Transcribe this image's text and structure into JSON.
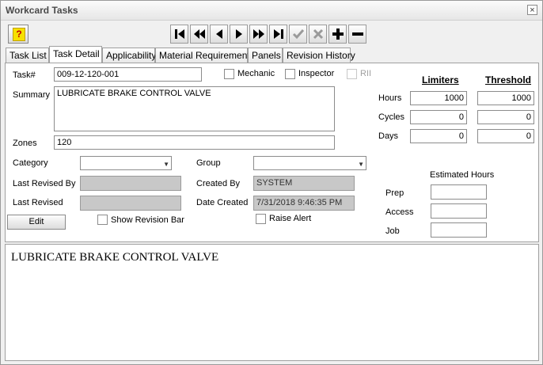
{
  "window": {
    "title": "Workcard Tasks",
    "close_glyph": "×"
  },
  "toolbar": {
    "help_glyph": "?",
    "buttons": [
      "first-icon",
      "prev-page-icon",
      "prev-icon",
      "next-icon",
      "next-page-icon",
      "last-icon",
      "check-icon",
      "cancel-icon",
      "add-icon",
      "remove-icon"
    ]
  },
  "tabs": [
    "Task List",
    "Task Detail",
    "Applicability",
    "Material Requirements",
    "Panels",
    "Revision History"
  ],
  "active_tab": "Task Detail",
  "form": {
    "task_label": "Task#",
    "task_value": "009-12-120-001",
    "summary_label": "Summary",
    "summary_value": "LUBRICATE BRAKE CONTROL VALVE",
    "zones_label": "Zones",
    "zones_value": "120",
    "mechanic_label": "Mechanic",
    "inspector_label": "Inspector",
    "rii_label": "RII",
    "category_label": "Category",
    "category_value": "",
    "group_label": "Group",
    "group_value": "",
    "last_revised_by_label": "Last Revised By",
    "last_revised_by_value": "",
    "created_by_label": "Created By",
    "created_by_value": "SYSTEM",
    "last_revised_label": "Last Revised",
    "last_revised_value": "",
    "date_created_label": "Date Created",
    "date_created_value": "7/31/2018 9:46:35 PM",
    "edit_label": "Edit",
    "show_revision_bar_label": "Show Revision Bar",
    "raise_alert_label": "Raise Alert"
  },
  "limits": {
    "limiters_header": "Limiters",
    "threshold_header": "Threshold",
    "rows": [
      {
        "label": "Hours",
        "limiter": "1000",
        "threshold": "1000"
      },
      {
        "label": "Cycles",
        "limiter": "0",
        "threshold": "0"
      },
      {
        "label": "Days",
        "limiter": "0",
        "threshold": "0"
      }
    ]
  },
  "estimated_hours": {
    "title": "Estimated Hours",
    "rows": [
      {
        "label": "Prep",
        "value": ""
      },
      {
        "label": "Access",
        "value": ""
      },
      {
        "label": "Job",
        "value": ""
      }
    ]
  },
  "description": {
    "text": "LUBRICATE BRAKE CONTROL VALVE"
  }
}
